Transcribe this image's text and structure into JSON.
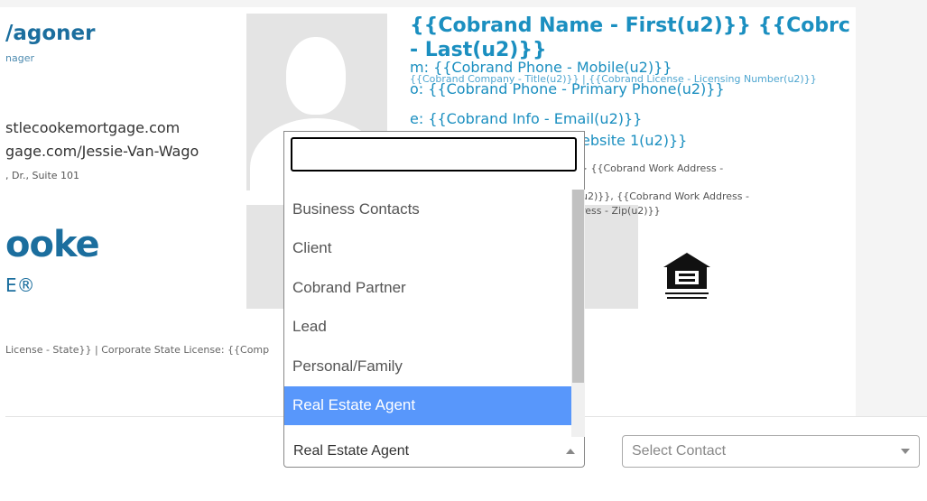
{
  "signature": {
    "name": "/agoner",
    "title": "nager",
    "url1": "stlecookemortgage.com",
    "url2": "gage.com/Jessie-Van-Wago",
    "address": ", Dr., Suite 101",
    "logo_text": "ooke",
    "logo_sub": "E®",
    "footer_license": "License - State}} | Corporate State License: {{Comp",
    "cobrand_name": "{{Cobrand Name - First(u2)}} {{Cobrc",
    "cobrand_last": "- Last(u2)}}",
    "phone_mobile": "m: {{Cobrand Phone - Mobile(u2)}}",
    "company_title": "{{Cobrand Company - Title(u2)}} | {{Cobrand License - Licensing Number(u2)}}",
    "phone_primary": "o:  {{Cobrand Phone - Primary Phone(u2)}}",
    "email": "e: {{Cobrand Info - Email(u2)}}",
    "website": "ebsite 1(u2)}}",
    "work_address_1": "} {{Cobrand Work Address -",
    "work_address_2": "u2)}}, {{Cobrand Work Address -",
    "work_address_3": "ress - Zip(u2)}}"
  },
  "dropdown": {
    "search_value": "",
    "options": [
      {
        "label": "Business Contacts",
        "selected": false
      },
      {
        "label": "Client",
        "selected": false
      },
      {
        "label": "Cobrand Partner",
        "selected": false
      },
      {
        "label": "Lead",
        "selected": false
      },
      {
        "label": "Personal/Family",
        "selected": false
      },
      {
        "label": "Real Estate Agent",
        "selected": true
      }
    ]
  },
  "contact_type_select": {
    "value": "Real Estate Agent"
  },
  "contact_select": {
    "placeholder": "Select Contact"
  },
  "colors": {
    "brand_blue": "#1b6e9e",
    "cobrand_blue": "#1b8fc0",
    "selected_highlight": "#5897fb"
  },
  "icons": {
    "equal_housing": "equal-housing-opportunity-icon",
    "avatar": "avatar-placeholder-icon"
  }
}
